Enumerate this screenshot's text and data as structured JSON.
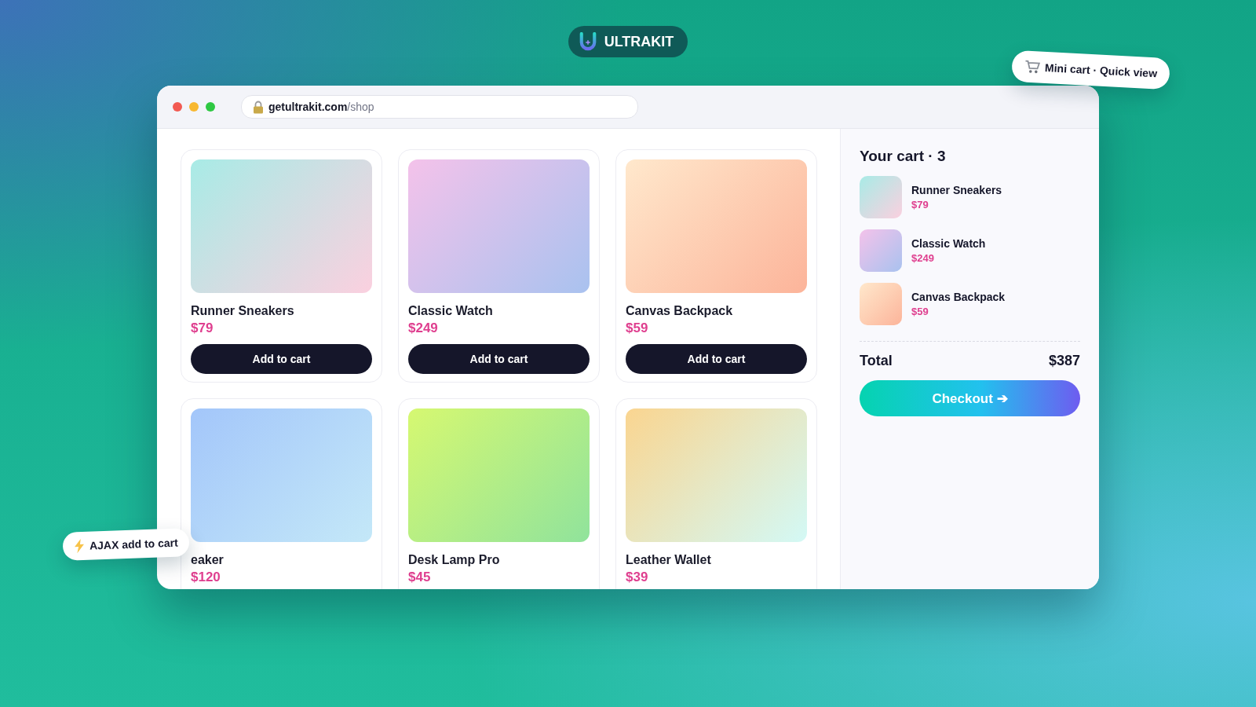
{
  "brand": {
    "name": "ULTRAKIT"
  },
  "badges": [
    {
      "kind": "cart",
      "label": "Mini cart · Quick view"
    },
    {
      "kind": "bolt",
      "label": "AJAX add to cart"
    }
  ],
  "browser": {
    "url_host": "getultrakit.com",
    "url_path": "/shop"
  },
  "products": [
    {
      "name": "Runner Sneakers",
      "price": "$79",
      "button": "Add to cart"
    },
    {
      "name": "Classic Watch",
      "price": "$249",
      "button": "Add to cart"
    },
    {
      "name": "Canvas Backpack",
      "price": "$59",
      "button": "Add to cart"
    },
    {
      "name": "eaker",
      "price": "$120"
    },
    {
      "name": "Desk Lamp Pro",
      "price": "$45"
    },
    {
      "name": "Leather Wallet",
      "price": "$39"
    }
  ],
  "cart": {
    "title": "Your cart · 3",
    "items": [
      {
        "name": "Runner Sneakers",
        "price": "$79"
      },
      {
        "name": "Classic Watch",
        "price": "$249"
      },
      {
        "name": "Canvas Backpack",
        "price": "$59"
      }
    ],
    "total_label": "Total",
    "total": "$387",
    "checkout": "Checkout ➔"
  }
}
